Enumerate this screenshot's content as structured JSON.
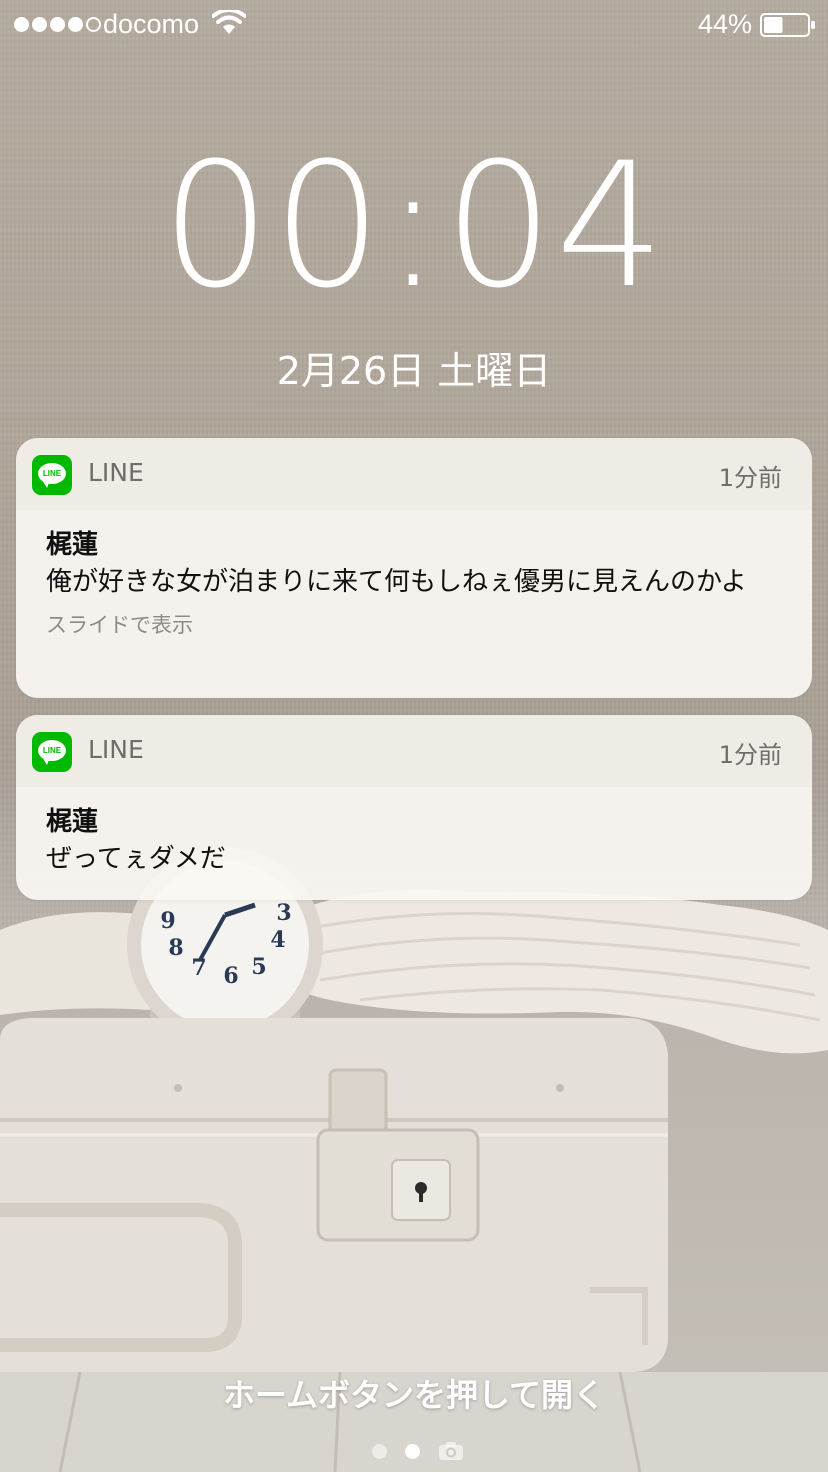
{
  "status_bar": {
    "signal_bars_filled": 4,
    "signal_bars_total": 5,
    "carrier": "docomo",
    "wifi_icon": "wifi-icon",
    "battery_percent": "44%",
    "battery_level": 0.44
  },
  "lock_screen": {
    "time": "00:04",
    "date": "2月26日 土曜日"
  },
  "notifications": [
    {
      "app_icon": "line-app-icon",
      "app_name": "LINE",
      "time_ago": "1分前",
      "sender": "梶蓮",
      "message": "俺が好きな女が泊まりに来て何もしねぇ優男に見えんのかよ",
      "hint": "スライドで表示"
    },
    {
      "app_icon": "line-app-icon",
      "app_name": "LINE",
      "time_ago": "1分前",
      "sender": "梶蓮",
      "message": "ぜってぇダメだ"
    }
  ],
  "bottom": {
    "unlock_text": "ホームボタンを押して開く",
    "page_count": 2,
    "active_page": 2,
    "camera_icon": "camera-icon"
  },
  "colors": {
    "line_green": "#00b900",
    "card_background": "#faf7f3",
    "text_primary": "#111111",
    "text_secondary": "#6f6d6a"
  }
}
